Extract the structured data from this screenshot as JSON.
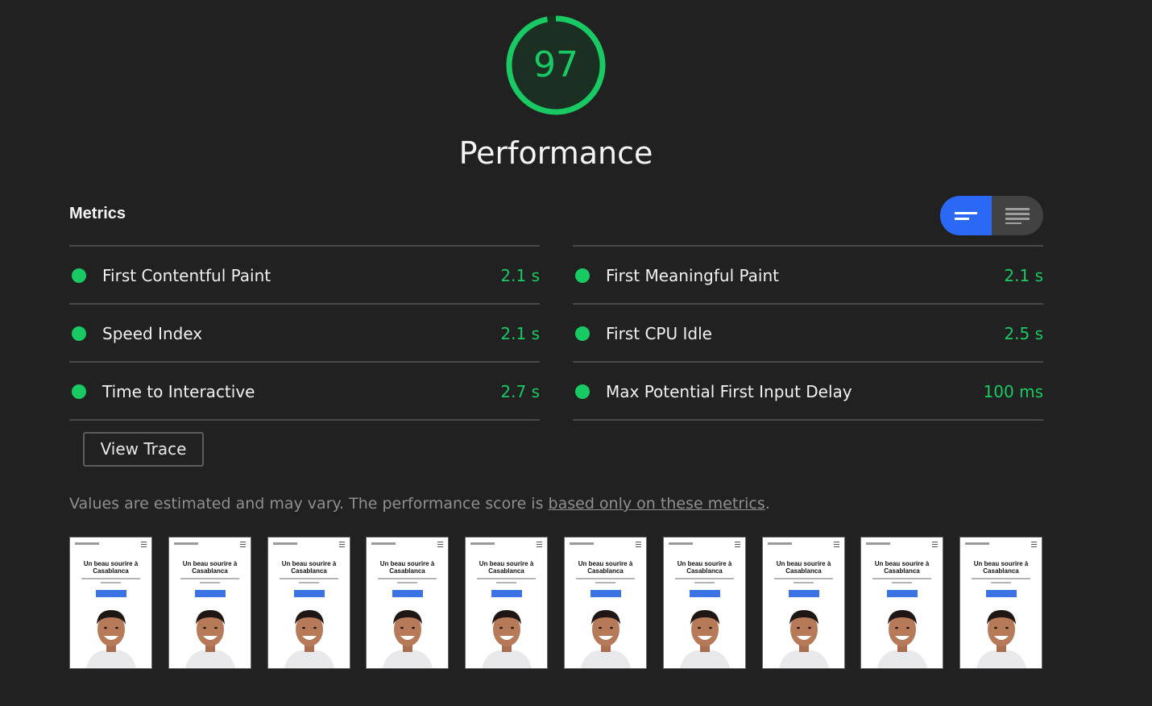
{
  "gauge": {
    "score": "97",
    "score_fraction": 0.97,
    "title": "Performance",
    "color": "#18c964"
  },
  "metrics": {
    "title": "Metrics",
    "toggle": {
      "active": "summary-view",
      "buttons": [
        "summary-view-icon",
        "list-view-icon"
      ],
      "accent": "#2a68f5"
    },
    "left": [
      {
        "label": "First Contentful Paint",
        "value": "2.1 s"
      },
      {
        "label": "Speed Index",
        "value": "2.1 s"
      },
      {
        "label": "Time to Interactive",
        "value": "2.7 s"
      }
    ],
    "right": [
      {
        "label": "First Meaningful Paint",
        "value": "2.1 s"
      },
      {
        "label": "First CPU Idle",
        "value": "2.5 s"
      },
      {
        "label": "Max Potential First Input Delay",
        "value": "100 ms"
      }
    ],
    "status_color": "#18c964"
  },
  "view_trace": {
    "label": "View Trace"
  },
  "note": {
    "text": "Values are estimated and may vary. The performance score is ",
    "link": "based only on these metrics",
    "end": "."
  },
  "filmstrip": {
    "frame_heading_line1": "Un beau sourire à",
    "frame_heading_line2": "Casablanca",
    "frames": 10
  }
}
